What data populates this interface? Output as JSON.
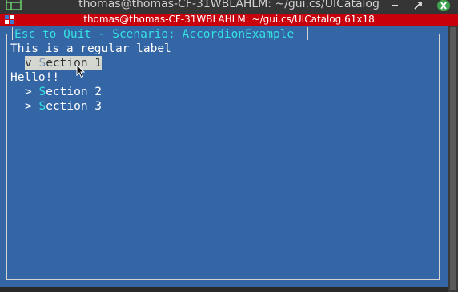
{
  "window": {
    "title": "thomas@thomas-CF-31WBLAHLM: ~/gui.cs/UICatalog",
    "minimize_icon": "minimize-icon",
    "maximize_icon": "maximize-icon",
    "close_icon": "close-icon"
  },
  "terminal": {
    "title": "thomas@thomas-CF-31WBLAHLM: ~/gui.cs/UICatalog 61x18",
    "background": "#3465a4",
    "titlebar_color": "#c8000c"
  },
  "frame": {
    "title": "Esc to Quit - Scenario: AccordionExample"
  },
  "content": {
    "regular_label": "This is a regular label",
    "sections": [
      {
        "arrow": "v",
        "hotkey": "S",
        "rest": "ection 1",
        "expanded": true,
        "body": "Hello!!"
      },
      {
        "arrow": ">",
        "hotkey": "S",
        "rest": "ection 2",
        "expanded": false
      },
      {
        "arrow": ">",
        "hotkey": "S",
        "rest": "ection 3",
        "expanded": false
      }
    ]
  }
}
